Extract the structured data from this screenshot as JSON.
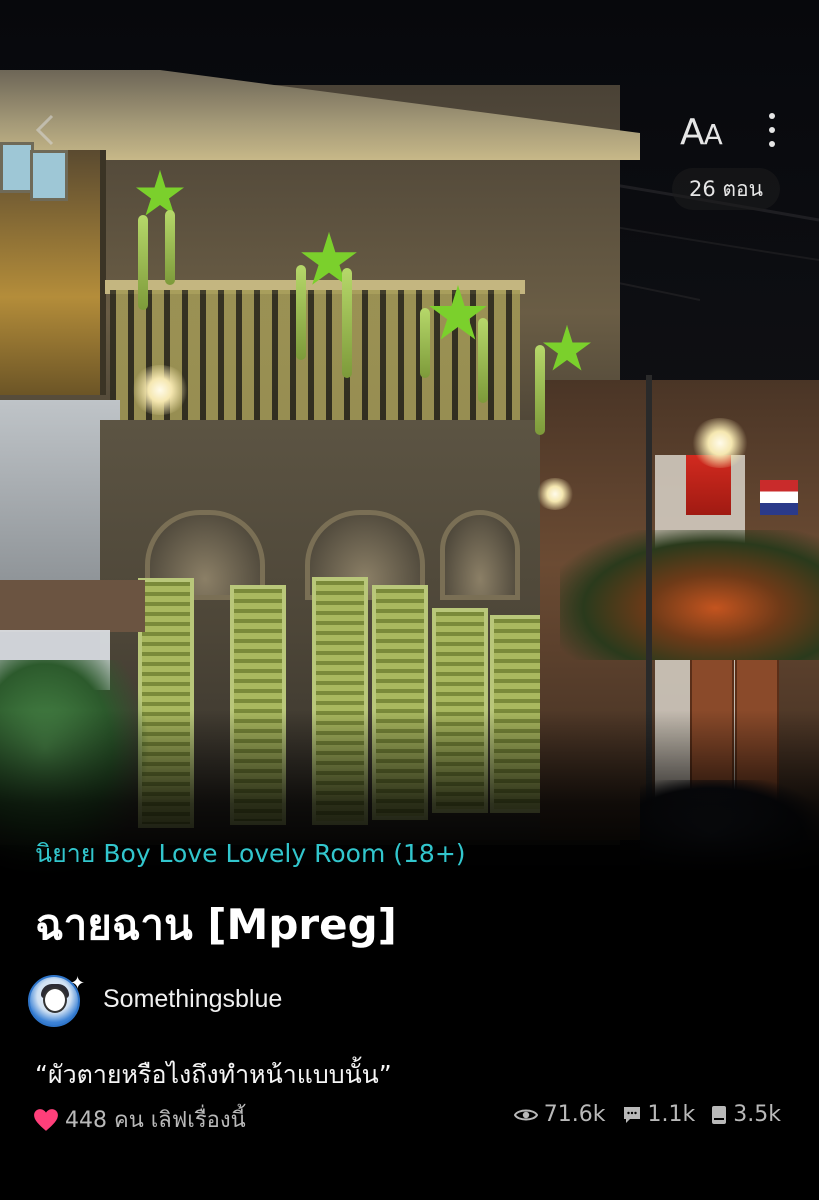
{
  "header": {
    "back_icon": "chevron-left-icon",
    "font_size_label_big": "A",
    "font_size_label_small": "A",
    "more_icon": "vertical-dots-icon",
    "episodes_badge": "26 ตอน"
  },
  "novel": {
    "category": "นิยาย Boy Love Lovely Room (18+)",
    "title": "ฉายฉาน [Mpreg]",
    "author": "Somethingsblue",
    "quote": "“ผัวตายหรือไงถึงทำหน้าแบบนั้น”",
    "likes_text": "448 คน เลิฟเรื่องนี้",
    "views": "71.6k",
    "comments": "1.1k",
    "bookmarks": "3.5k"
  },
  "colors": {
    "accent": "#32c6cd",
    "heart": "#ff3f7a",
    "background": "#000000"
  },
  "icons": {
    "heart": "heart-icon",
    "views": "eye-icon",
    "comments": "comment-icon",
    "bookmarks": "book-icon"
  }
}
